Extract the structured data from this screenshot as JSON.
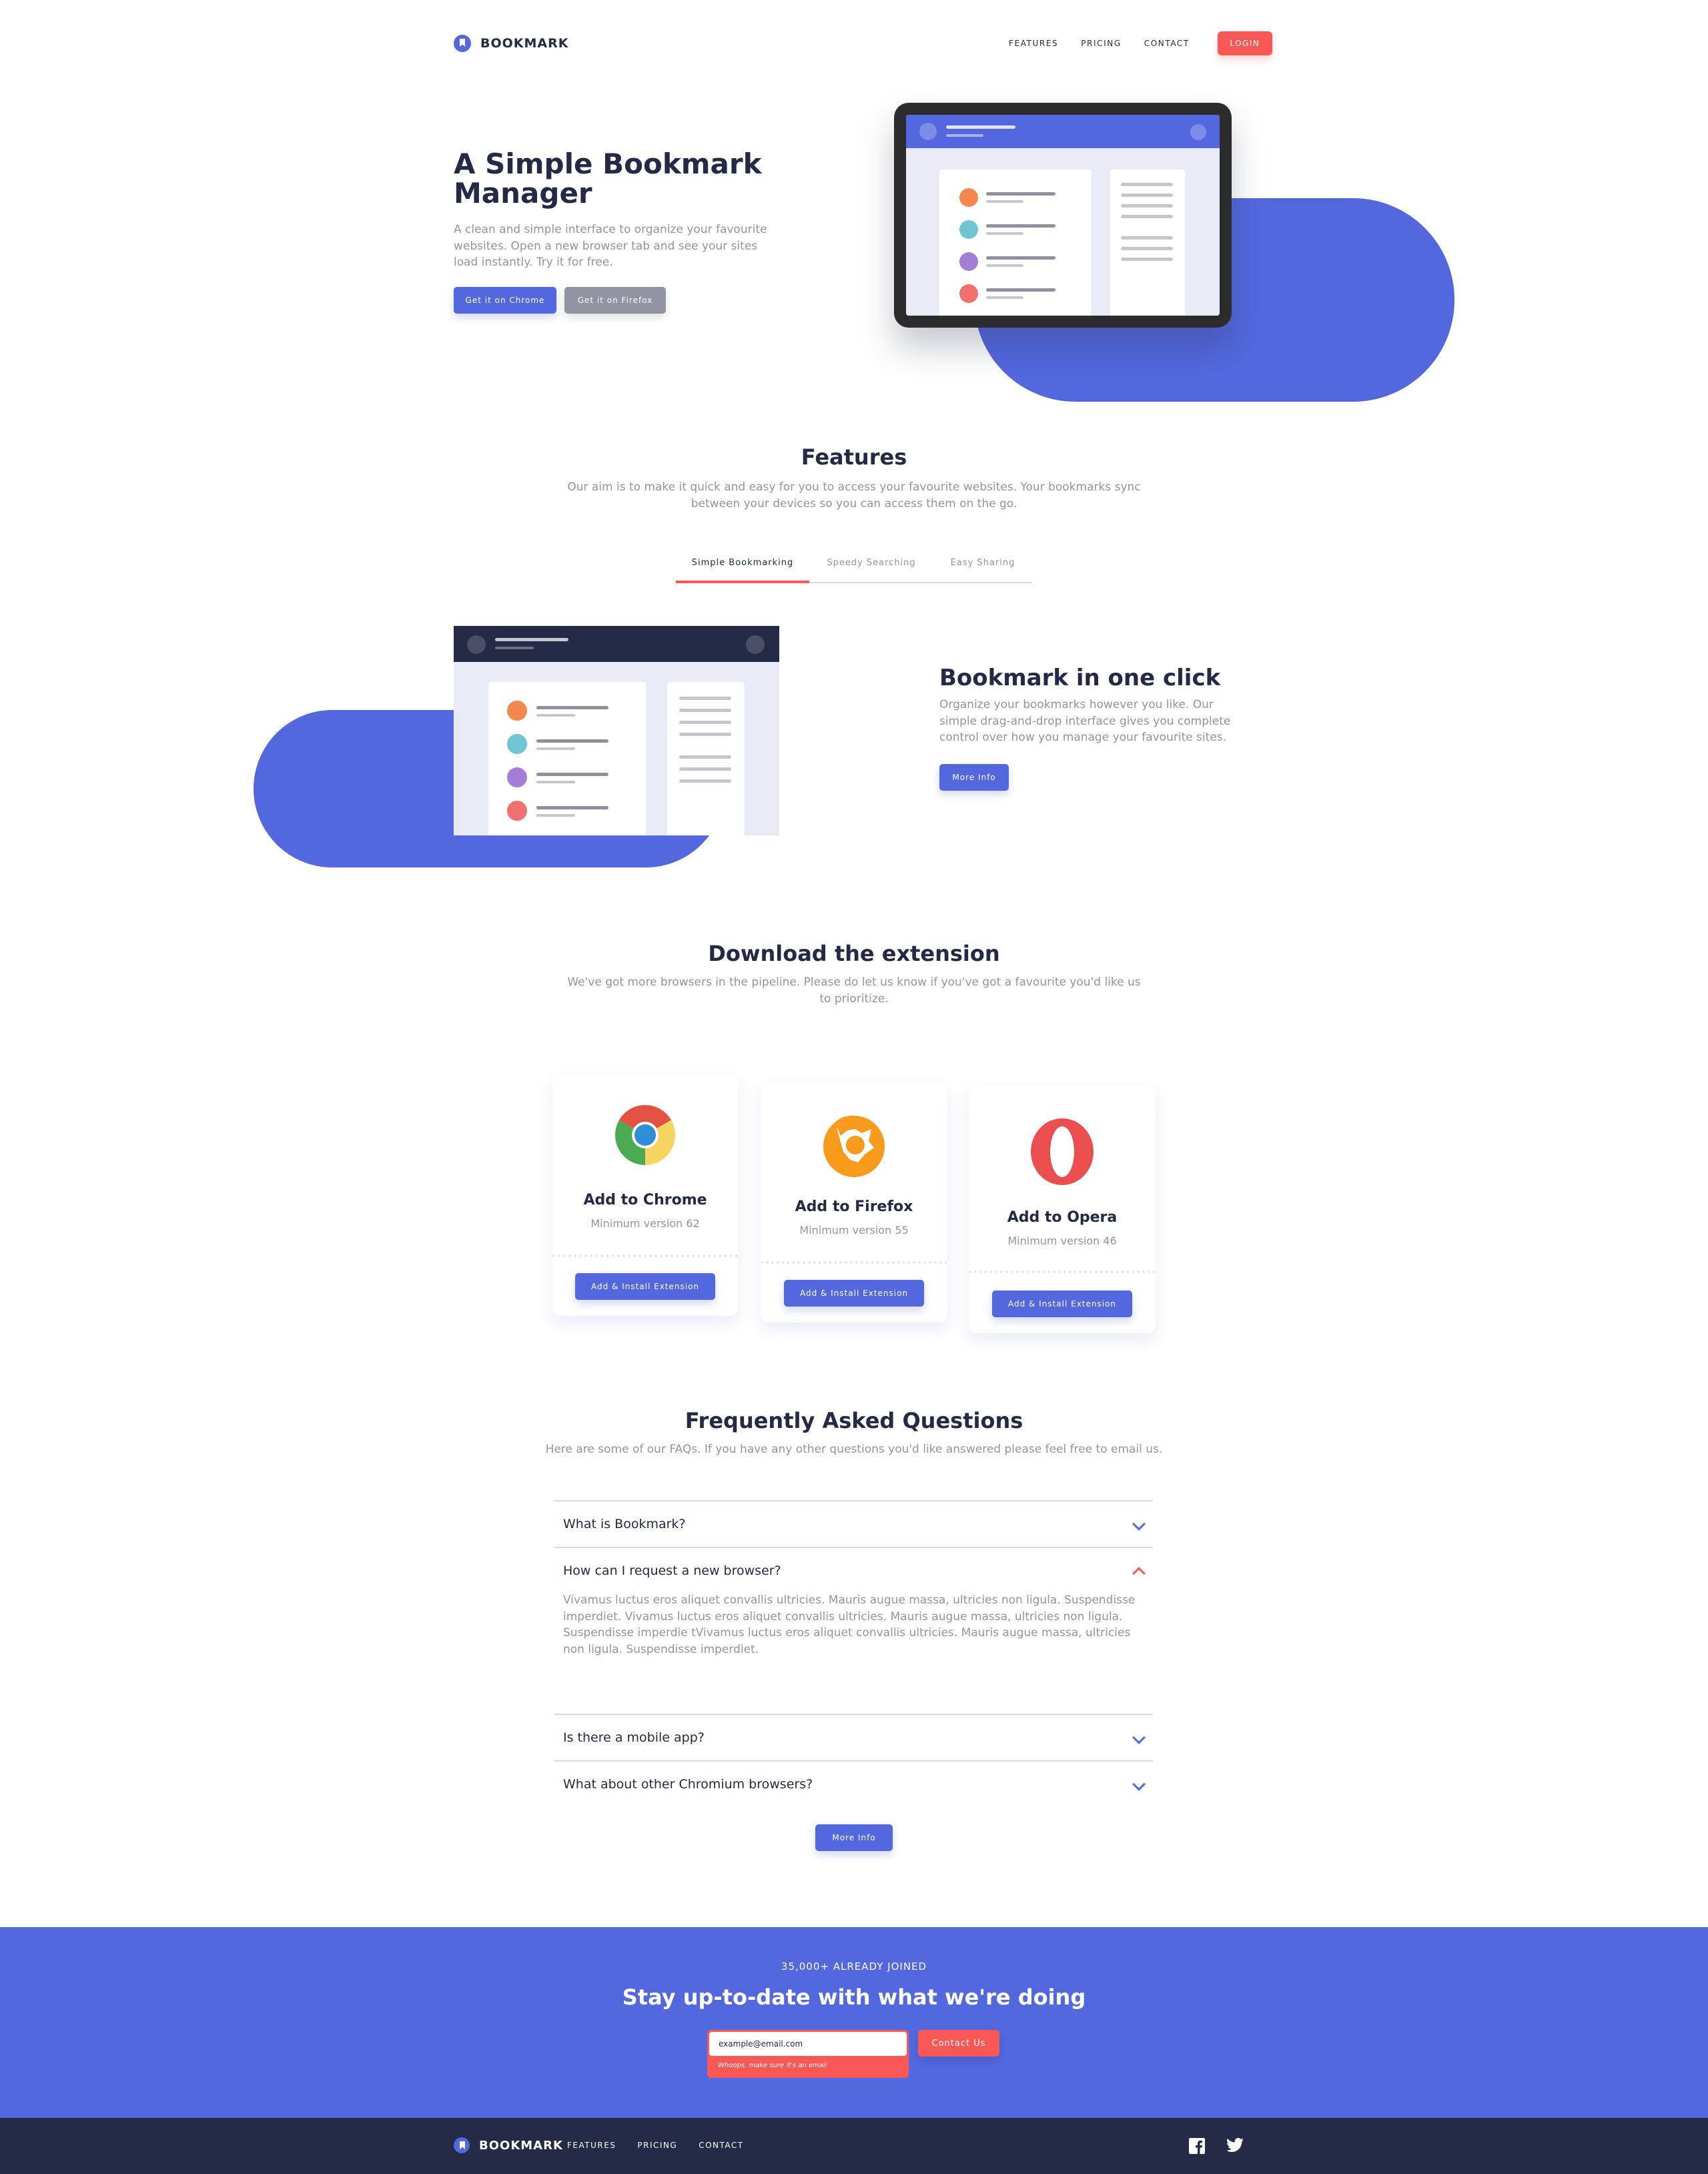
{
  "header": {
    "logo_text": "BOOKMARK",
    "nav": [
      "FEATURES",
      "PRICING",
      "CONTACT"
    ],
    "login_label": "LOGIN"
  },
  "hero": {
    "title_line1": "A Simple Bookmark",
    "title_line2": "Manager",
    "description": "A clean and simple interface to organize your favourite websites. Open a new browser tab and see your sites load instantly. Try it for free.",
    "chrome_btn": "Get it on Chrome",
    "firefox_btn": "Get it on Firefox"
  },
  "features": {
    "title": "Features",
    "description": "Our aim is to make it quick and easy for you to access your favourite websites. Your bookmarks sync between your devices so you can access them on the go.",
    "tabs": [
      "Simple Bookmarking",
      "Speedy Searching",
      "Easy Sharing"
    ],
    "active_tab": "Simple Bookmarking",
    "panel_title": "Bookmark in one click",
    "panel_text": "Organize your bookmarks however you like. Our simple drag-and-drop interface gives you complete control over how you manage your favourite sites.",
    "panel_btn": "More Info"
  },
  "download": {
    "title": "Download the extension",
    "description": "We've got more browsers in the pipeline. Please do let us know if you've got a favourite you'd like us to prioritize.",
    "cards": [
      {
        "title": "Add to Chrome",
        "version": "Minimum version 62",
        "button": "Add & Install Extension",
        "icon": "chrome-icon"
      },
      {
        "title": "Add to Firefox",
        "version": "Minimum version 55",
        "button": "Add & Install Extension",
        "icon": "firefox-icon"
      },
      {
        "title": "Add to Opera",
        "version": "Minimum version 46",
        "button": "Add & Install Extension",
        "icon": "opera-icon"
      }
    ]
  },
  "faq": {
    "title": "Frequently Asked Questions",
    "description": "Here are some of our FAQs. If you have any other questions you'd like answered please feel free to email us.",
    "items": [
      {
        "question": "What is Bookmark?",
        "open": false
      },
      {
        "question": "How can I request a new browser?",
        "open": true,
        "answer": "Vivamus luctus eros aliquet convallis ultricies. Mauris augue massa, ultricies non ligula. Suspendisse imperdiet. Vivamus luctus eros aliquet convallis ultricies. Mauris augue massa, ultricies non ligula. Suspendisse imperdie tVivamus luctus eros aliquet convallis ultricies. Mauris augue massa, ultricies non ligula. Suspendisse imperdiet."
      },
      {
        "question": "Is there a mobile app?",
        "open": false
      },
      {
        "question": "What about other Chromium browsers?",
        "open": false
      }
    ],
    "more_btn": "More Info"
  },
  "newsletter": {
    "kicker": "35,000+ ALREADY JOINED",
    "title": "Stay up-to-date with what we're doing",
    "email_value": "example@email.com",
    "error": "Whoops, make sure it's an email",
    "button": "Contact Us"
  },
  "footer": {
    "logo_text": "BOOKMARK",
    "nav": [
      "FEATURES",
      "PRICING",
      "CONTACT"
    ],
    "social": [
      "facebook-icon",
      "twitter-icon"
    ]
  },
  "colors": {
    "primary": "#5368df",
    "accent": "#fa5757",
    "dark": "#242a45",
    "grey": "#9194a1"
  }
}
